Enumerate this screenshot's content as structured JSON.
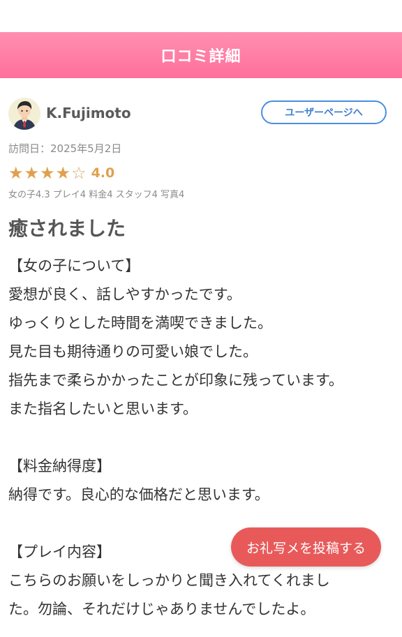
{
  "header": {
    "title": "口コミ詳細"
  },
  "user": {
    "name": "K.Fujimoto",
    "user_page_label": "ユーザーページへ"
  },
  "visit": {
    "date_text": "訪問日：2025年5月2日"
  },
  "rating": {
    "value_text": "4.0",
    "stars_filled": 4,
    "stars_total": 5,
    "sub_scores_text": "女の子4.3 プレイ4 料金4 スタッフ4 写真4"
  },
  "review": {
    "title": "癒されました",
    "body": "【女の子について】\n愛想が良く、話しやすかったです。\nゆっくりとした時間を満喫できました。\n見た目も期待通りの可愛い娘でした。\n指先まで柔らかかったことが印象に残っています。\nまた指名したいと思います。\n\n【料金納得度】\n納得です。良心的な価格だと思います。\n\n【プレイ内容】\nこちらのお願いをしっかりと聞き入れてくれまし\nた。勿論、それだけじゃありませんでしたよ。"
  },
  "actions": {
    "thanks_photo_label": "お礼写メを投稿する"
  },
  "colors": {
    "header_gradient_top": "#ff8fb1",
    "header_gradient_bottom": "#ff6f9b",
    "star": "#e0a050",
    "user_button_border": "#4a8ee0",
    "thanks_button": "#e85a5a"
  },
  "icons": {
    "avatar": "user-avatar-icon",
    "star_filled": "star-filled-icon",
    "star_empty": "star-outline-icon"
  }
}
